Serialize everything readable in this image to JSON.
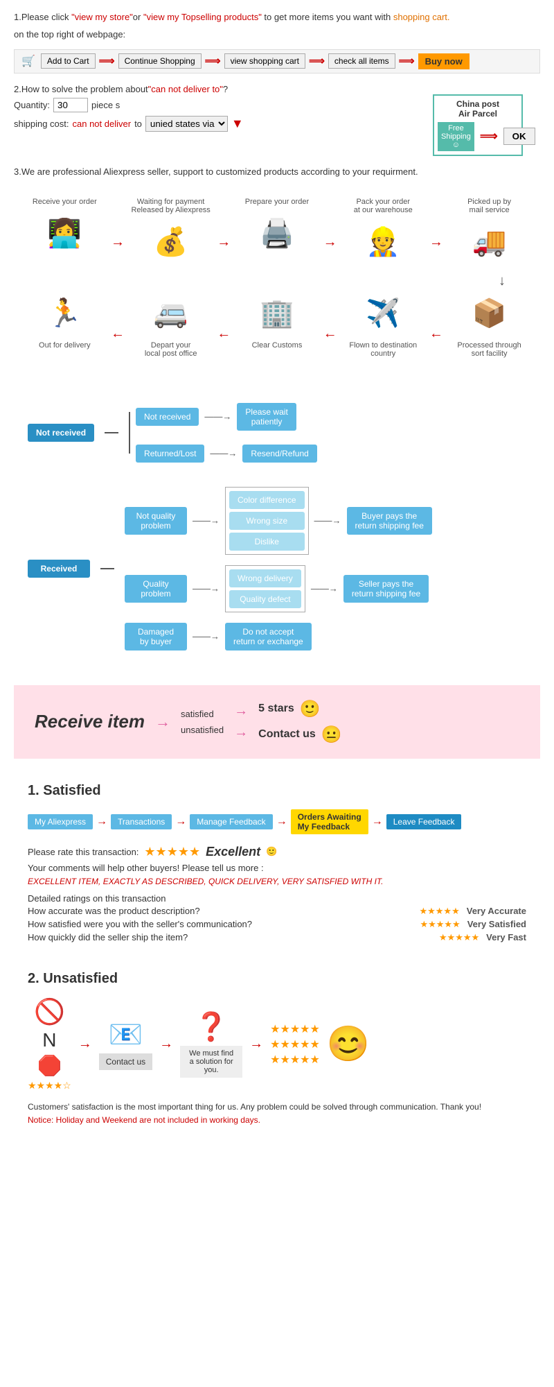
{
  "page": {
    "section1": {
      "text1": "1.Please click ",
      "link1": "\"view my store\"",
      "text2": "or ",
      "link2": "\"view my Topselling products\"",
      "text3": " to get more items you want with shopping cart.",
      "text4": " on the top right of webpage:",
      "bar": {
        "add_to_cart": "Add to Cart",
        "continue": "Continue Shopping",
        "view_cart": "view shopping cart",
        "check_all": "check all items",
        "buy_now": "Buy now"
      }
    },
    "section2": {
      "title": "2.How to solve the problem about",
      "highlight": "\"can not deliver to\"",
      "text2": "?",
      "qty_label": "Quantity:",
      "qty_value": "30",
      "qty_unit": "piece s",
      "ship_label": "shipping cost:",
      "cant_deliver": "can not deliver",
      "ship_text": " to ",
      "ship_via": "unied states via",
      "china_post_title": "China post",
      "china_post_subtitle": "Air Parcel",
      "free_shipping": "Free Shipping",
      "ok_btn": "OK"
    },
    "section3": {
      "text": "3.We are professional Aliexpress seller, support to customized products according to your requirment."
    },
    "process": {
      "steps_top": [
        {
          "label": "Receive your order",
          "icon": "👩‍💻"
        },
        {
          "label": "Waiting for payment\nReleased by Aliexpress",
          "icon": "💰"
        },
        {
          "label": "Prepare your order",
          "icon": "🖨️"
        },
        {
          "label": "Pack your order\nat our warehouse",
          "icon": "👷"
        },
        {
          "label": "Picked up by\nmail service",
          "icon": "🚚"
        }
      ],
      "steps_bottom": [
        {
          "label": "Out for delivery",
          "icon": "🏃"
        },
        {
          "label": "Depart your\nlocal post office",
          "icon": "🚐"
        },
        {
          "label": "Clear Customs",
          "icon": "🏢"
        },
        {
          "label": "Flown to destination\ncountry",
          "icon": "✈️"
        },
        {
          "label": "Processed through\nsort facility",
          "icon": "📦"
        }
      ]
    },
    "not_received_diagram": {
      "main": "Not received",
      "branch1": "Not received",
      "result1": "Please wait\npatiently",
      "branch2": "Returned/Lost",
      "result2": "Resend/Refund"
    },
    "received_diagram": {
      "main": "Received",
      "branch1_title": "Not quality\nproblem",
      "branch1_sub": [
        "Color difference",
        "Wrong size",
        "Dislike"
      ],
      "branch1_result": "Buyer pays the\nreturn shipping fee",
      "branch2_title": "Quality\nproblem",
      "branch2_sub": [
        "Wrong delivery",
        "Quality defect"
      ],
      "branch2_result": "Seller pays the\nreturn shipping fee",
      "branch3_title": "Damaged\nby buyer",
      "branch3_result": "Do not accept\nreturn or exchange"
    },
    "pink_section": {
      "title": "Receive item",
      "items": [
        "satisfied",
        "unsatisfied"
      ],
      "results": [
        "5 stars",
        "Contact us"
      ],
      "emoji1": "🙂",
      "emoji2": "😐"
    },
    "satisfied_section": {
      "title": "1. Satisfied",
      "steps": [
        "My Aliexpress",
        "Transactions",
        "Manage Feedback",
        "Orders Awaiting\nMy Feedback",
        "Leave Feedback"
      ],
      "rate_label": "Please rate this transaction:",
      "stars": "★★★★★",
      "excellent": "Excellent",
      "emoji": "🙂",
      "comment1": "Your comments will help other buyers! Please tell us more :",
      "comment2": "EXCELLENT ITEM, EXACTLY AS DESCRIBED, QUICK DELIVERY, VERY SATISFIED WITH IT.",
      "ratings_title": "Detailed ratings on this transaction",
      "rating1_q": "How accurate was the product description?",
      "rating1_v": "★★★★★",
      "rating1_l": "Very Accurate",
      "rating2_q": "How satisfied were you with the seller's communication?",
      "rating2_v": "★★★★★",
      "rating2_l": "Very Satisfied",
      "rating3_q": "How quickly did the seller ship the item?",
      "rating3_v": "★★★★★",
      "rating3_l": "Very Fast"
    },
    "unsatisfied_section": {
      "title": "2. Unsatisfied",
      "flow": [
        "🚫",
        "→",
        "📧",
        "→",
        "❓",
        "→",
        "⭐"
      ],
      "contact_us": "Contact us",
      "find_solution": "We must find\na solution for\nyou.",
      "footer1": "Customers' satisfaction is the most important thing for us. Any problem could be solved through communication. Thank you!",
      "notice": "Notice: Holiday and Weekend are not included in working days."
    }
  }
}
